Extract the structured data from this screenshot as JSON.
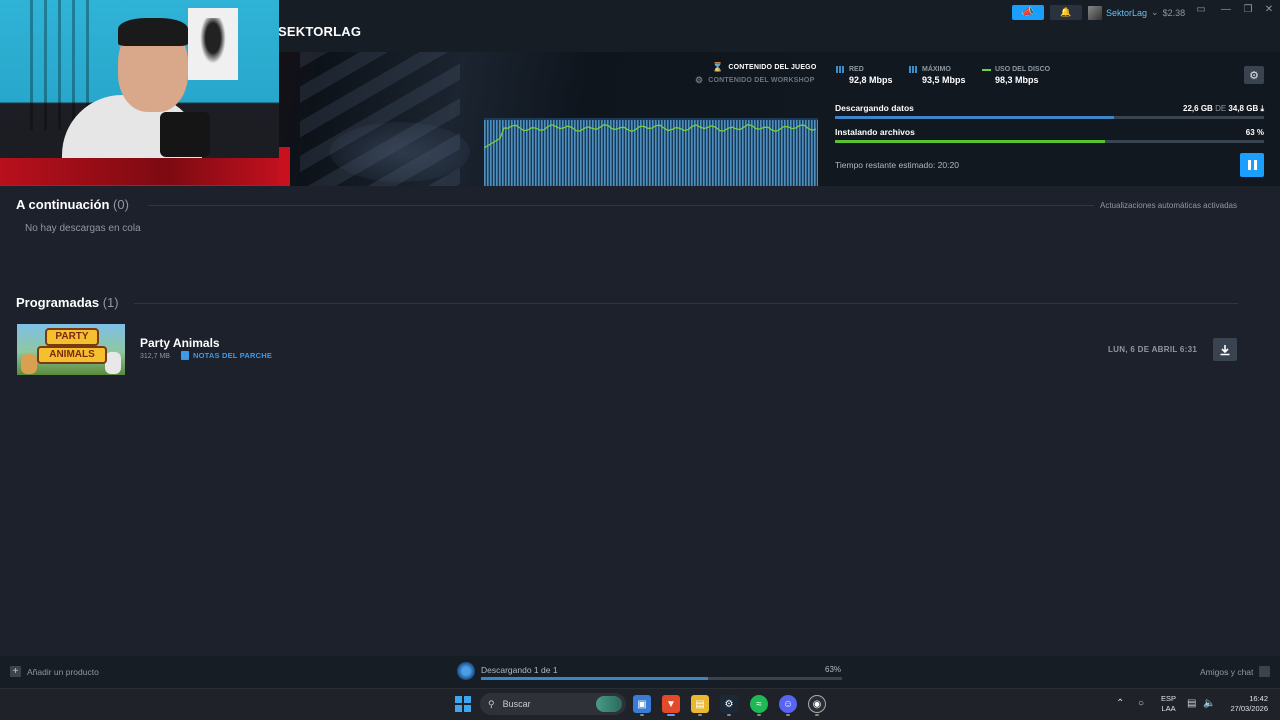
{
  "header": {
    "nav_title": "SEKTORLAG",
    "user_name": "SektorLag",
    "user_balance": "$2.38"
  },
  "hero": {
    "content_game": "CONTENIDO DEL JUEGO",
    "content_workshop": "CONTENIDO DEL WORKSHOP",
    "stats": [
      {
        "label": "RED",
        "value": "92,8 Mbps"
      },
      {
        "label": "MÁXIMO",
        "value": "93,5 Mbps"
      },
      {
        "label": "USO DEL DISCO",
        "value": "98,3 Mbps"
      }
    ],
    "downloading_label": "Descargando datos",
    "downloaded": "22,6 GB",
    "of_text": "DE",
    "total": "34,8 GB",
    "download_fraction": 0.65,
    "installing_label": "Instalando archivos",
    "install_percent": "63 %",
    "install_fraction": 0.63,
    "remaining": "Tiempo restante estimado: 20:20"
  },
  "queue": {
    "title": "A continuación",
    "count": "(0)",
    "empty_text": "No hay descargas en cola",
    "auto_updates": "Actualizaciones automáticas activadas"
  },
  "scheduled": {
    "title": "Programadas",
    "count": "(1)",
    "items": [
      {
        "name": "Party Animals",
        "size": "312,7 MB",
        "patch_notes": "NOTAS DEL PARCHE",
        "date": "LUN, 6 DE ABRIL 6:31",
        "thumb_line1": "PARTY",
        "thumb_line2": "ANIMALS"
      }
    ]
  },
  "bottombar": {
    "add_product": "Añadir un producto",
    "downloading": "Descargando 1 de 1",
    "percent": "63%",
    "progress_fraction": 0.63,
    "friends": "Amigos y chat"
  },
  "taskbar": {
    "search_placeholder": "Buscar",
    "lang_line1": "ESP",
    "lang_line2": "LAA",
    "time": "16:42",
    "date": "27/03/2026"
  },
  "colors": {
    "accent": "#1a9fff",
    "progress_blue": "#3d85c6",
    "progress_green": "#56c234",
    "link": "#3d9ae8"
  }
}
